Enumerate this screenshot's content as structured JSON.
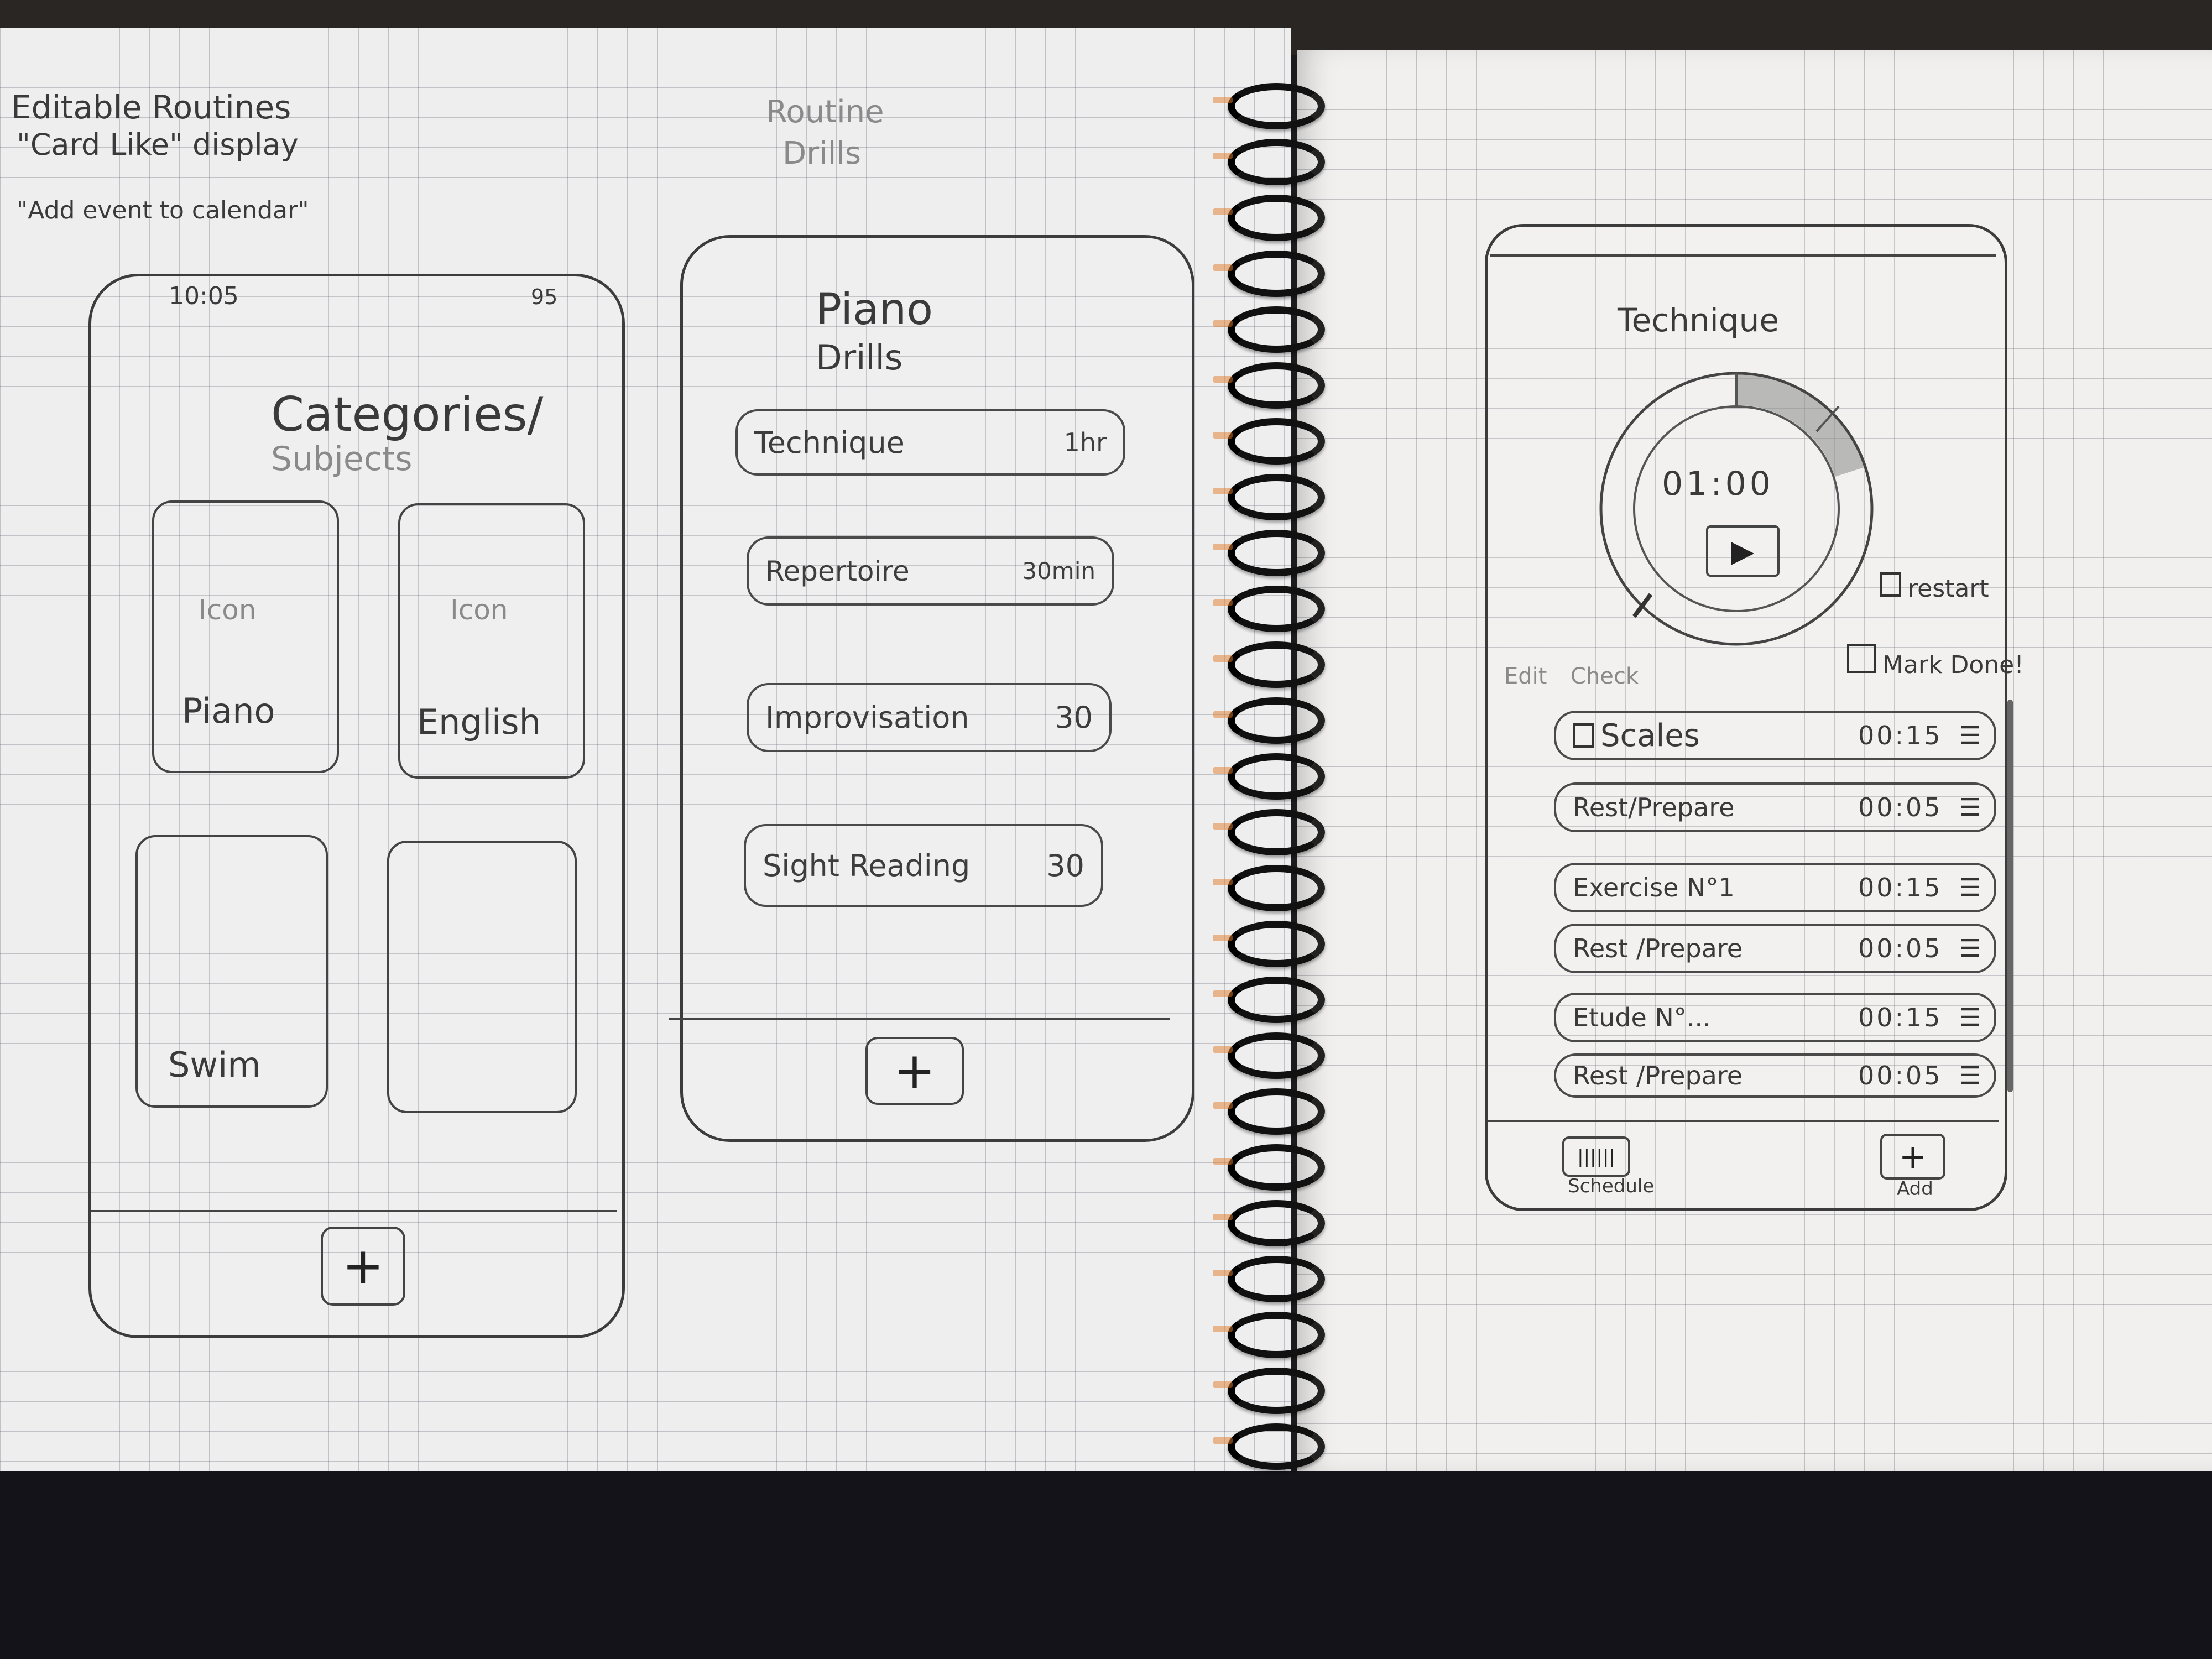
{
  "notes": {
    "line1": "Editable Routines",
    "line2": "\"Card Like\" display",
    "line3": "\"Add event to calendar\"",
    "routine_note_1": "Routine",
    "routine_note_2": "Drills"
  },
  "screen1": {
    "time": "10:05",
    "battery": "95",
    "title_line1": "Categories/",
    "title_line2": "Subjects",
    "cards": [
      {
        "icon_label": "Icon",
        "label": "Piano"
      },
      {
        "icon_label": "Icon",
        "label": "English"
      },
      {
        "icon_label": "",
        "label": "Swim"
      },
      {
        "icon_label": "",
        "label": ""
      }
    ],
    "add_label": "+"
  },
  "screen2": {
    "title_line1": "Piano",
    "title_line2": "Drills",
    "drills": [
      {
        "name": "Technique",
        "duration": "1hr"
      },
      {
        "name": "Repertoire",
        "duration": "30min"
      },
      {
        "name": "Improvisation",
        "duration": "30"
      },
      {
        "name": "Sight Reading",
        "duration": "30"
      }
    ],
    "add_label": "+"
  },
  "screen3": {
    "title": "Technique",
    "timer": "01:00",
    "play_label": "▶",
    "restart_label": "restart",
    "mark_done_label": "Mark Done!",
    "edit_label": "Edit",
    "check_label": "Check",
    "rows": [
      {
        "label": "Scales",
        "time": "00:15"
      },
      {
        "label": "Rest/Prepare",
        "time": "00:05"
      },
      {
        "label": "Exercise N°1",
        "time": "00:15"
      },
      {
        "label": "Rest /Prepare",
        "time": "00:05"
      },
      {
        "label": "Etude N°...",
        "time": "00:15"
      },
      {
        "label": "Rest /Prepare",
        "time": "00:05"
      }
    ],
    "schedule_label": "Schedule",
    "add_label": "Add",
    "add_icon": "+",
    "timer_progress": 0.2
  }
}
